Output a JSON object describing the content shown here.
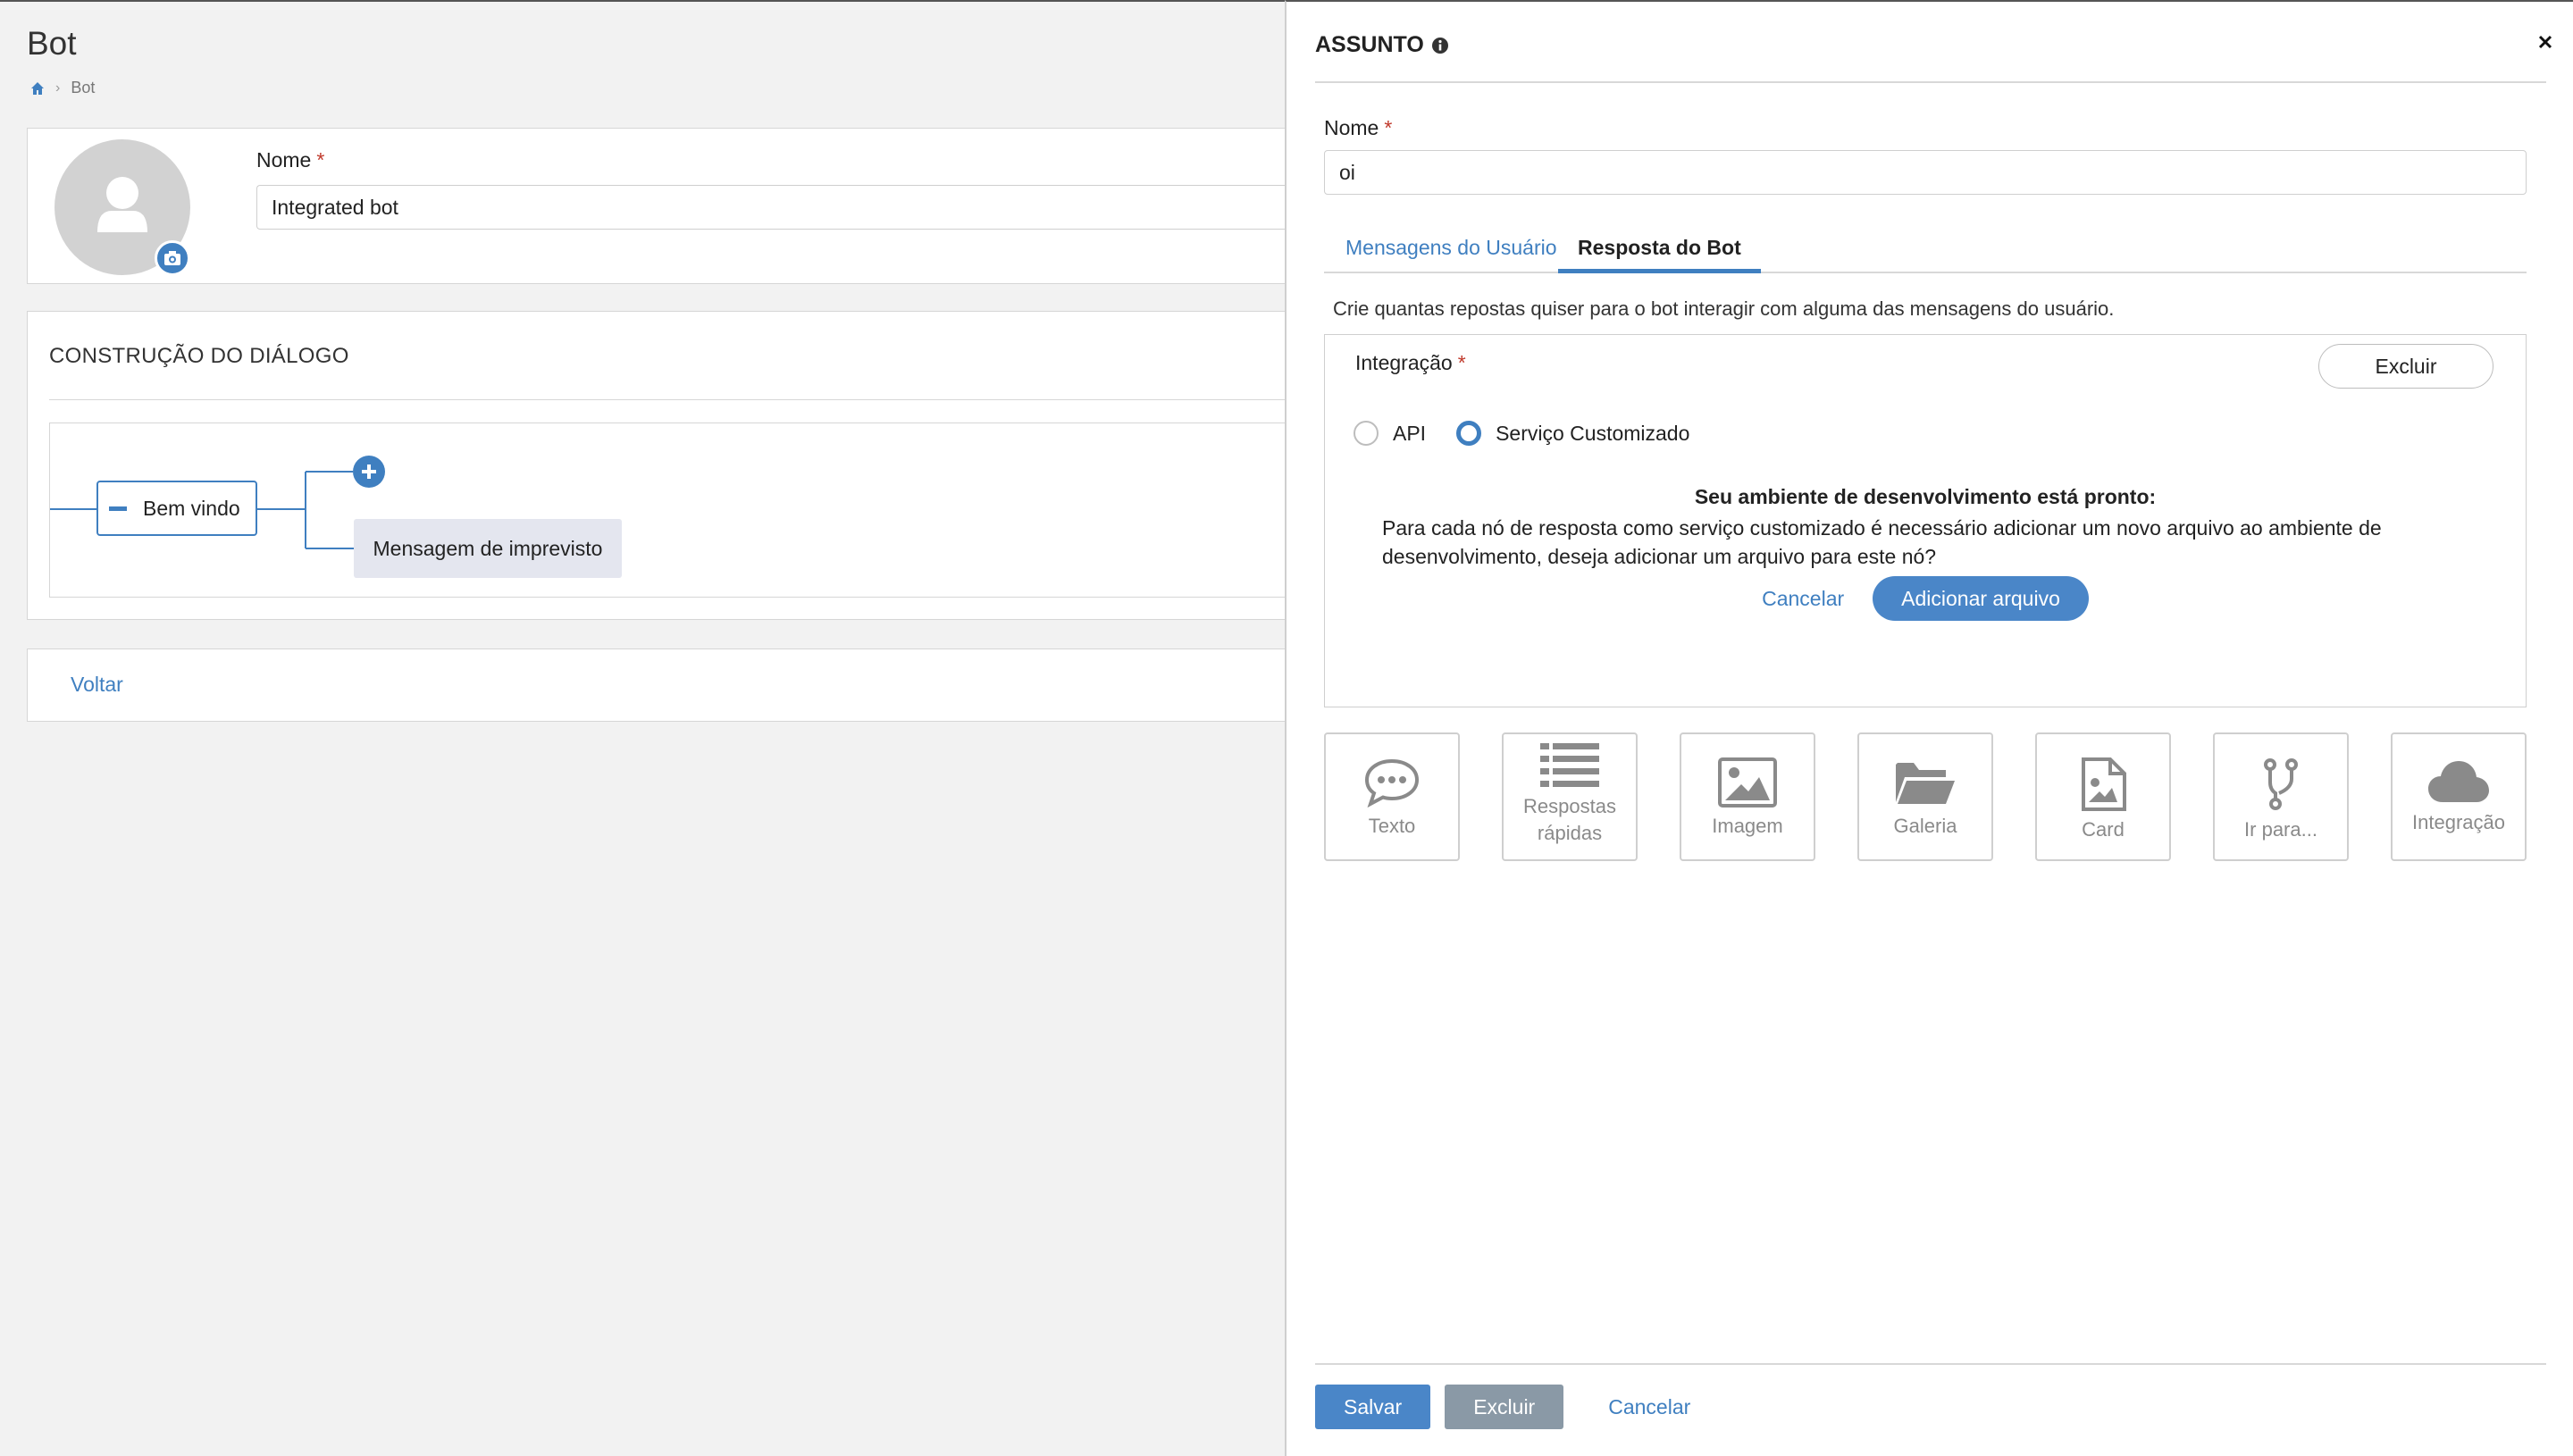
{
  "page": {
    "title": "Bot",
    "breadcrumb": [
      "Bot"
    ]
  },
  "profile": {
    "name_label": "Nome",
    "name_value": "Integrated bot"
  },
  "dialog": {
    "section_title": "CONSTRUÇÃO DO DIÁLOGO",
    "nodes": {
      "welcome": "Bem vindo",
      "fallback": "Mensagem de imprevisto"
    }
  },
  "back_link": "Voltar",
  "panel": {
    "title": "ASSUNTO",
    "name_label": "Nome",
    "name_value": "oi",
    "tabs": [
      {
        "label": "Mensagens do Usuário",
        "active": false
      },
      {
        "label": "Resposta do Bot",
        "active": true
      }
    ],
    "helper_text": "Crie quantas repostas quiser para o bot interagir com alguma das mensagens do usuário.",
    "integration": {
      "label": "Integração",
      "delete_label": "Excluir",
      "options": [
        {
          "label": "API",
          "checked": false
        },
        {
          "label": "Serviço Customizado",
          "checked": true
        }
      ],
      "ready_title": "Seu ambiente de desenvolvimento está pronto:",
      "ready_text": "Para cada nó de resposta como serviço customizado é necessário adicionar um novo arquivo ao ambiente de desenvolvimento, deseja adicionar um arquivo para este nó?",
      "cancel_label": "Cancelar",
      "add_file_label": "Adicionar arquivo"
    },
    "tiles": [
      {
        "label": "Texto",
        "icon": "speech-bubble-icon"
      },
      {
        "label": "Respostas rápidas",
        "icon": "list-icon"
      },
      {
        "label": "Imagem",
        "icon": "image-icon"
      },
      {
        "label": "Galeria",
        "icon": "folder-open-icon"
      },
      {
        "label": "Card",
        "icon": "file-image-icon"
      },
      {
        "label": "Ir para...",
        "icon": "branch-icon"
      },
      {
        "label": "Integração",
        "icon": "cloud-icon"
      }
    ],
    "footer": {
      "save_label": "Salvar",
      "delete_label": "Excluir",
      "cancel_label": "Cancelar"
    }
  },
  "colors": {
    "accent": "#4a86c8",
    "link": "#3f7fc0",
    "secondary_button": "#8a99a6",
    "required": "#c0392b"
  }
}
